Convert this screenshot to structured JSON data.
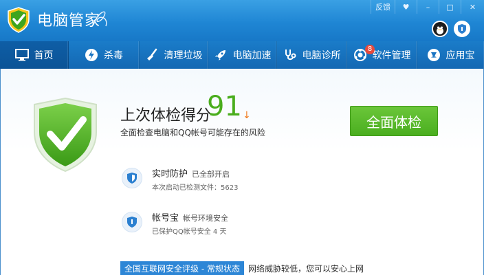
{
  "app": {
    "title": "电脑管家",
    "window_controls": [
      "反馈",
      "♥",
      "–",
      "□",
      "✕"
    ]
  },
  "tabs": [
    {
      "label": "首页",
      "icon": "monitor-icon",
      "active": true
    },
    {
      "label": "杀毒",
      "icon": "lightning-icon"
    },
    {
      "label": "清理垃圾",
      "icon": "broom-icon"
    },
    {
      "label": "电脑加速",
      "icon": "rocket-icon"
    },
    {
      "label": "电脑诊所",
      "icon": "stethoscope-icon"
    },
    {
      "label": "软件管理",
      "icon": "software-icon",
      "badge": "8"
    },
    {
      "label": "应用宝",
      "icon": "app-store-icon"
    }
  ],
  "score": {
    "title": "上次体检得分",
    "value": "91",
    "arrow": "↓",
    "description": "全面检查电脑和QQ帐号可能存在的风险"
  },
  "scan_button": "全面体检",
  "features": [
    {
      "name": "实时防护",
      "status": "已全部开启",
      "sub": "本次启动已检测文件：5623"
    },
    {
      "name": "帐号宝",
      "status": "帐号环境安全",
      "sub": "已保护QQ帐号安全  4 天"
    }
  ],
  "level": {
    "tag": "全国互联网安全评级 - 常规状态",
    "desc": "网络威胁较低，您可以安心上网"
  },
  "colors": {
    "accent": "#1f86d4",
    "score": "#49ad1c",
    "button": "#55b428",
    "arrow": "#f07a1e"
  }
}
